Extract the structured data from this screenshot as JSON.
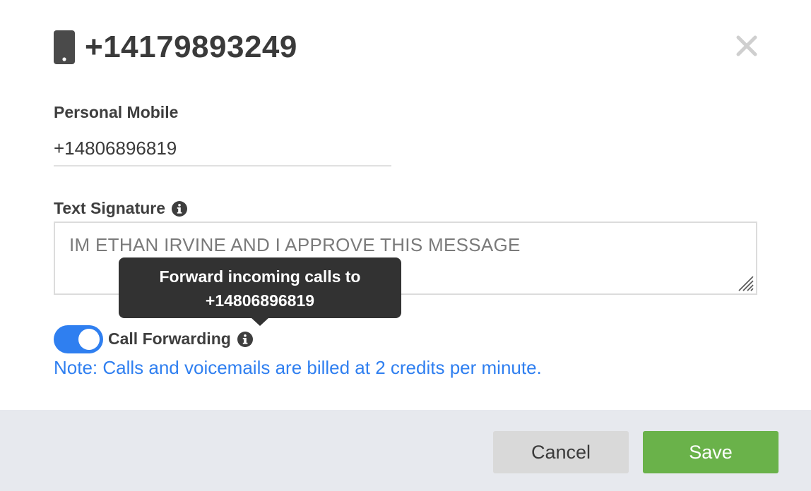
{
  "dialog": {
    "title": "+14179893249",
    "icons": {
      "title": "mobile-phone-icon",
      "close": "close-icon",
      "info": "info-icon"
    }
  },
  "personal_mobile": {
    "label": "Personal Mobile",
    "value": "+14806896819"
  },
  "text_signature": {
    "label": "Text Signature",
    "value": "IM ETHAN IRVINE AND I APPROVE THIS MESSAGE"
  },
  "tooltip": {
    "line1": "Forward incoming calls to",
    "line2": "+14806896819"
  },
  "call_forwarding": {
    "label": "Call Forwarding",
    "enabled": true,
    "note": "Note: Calls and voicemails are billed at 2 credits per minute."
  },
  "footer": {
    "cancel_label": "Cancel",
    "save_label": "Save"
  },
  "colors": {
    "accent": "#2f7ff0",
    "save": "#6ab24a",
    "cancel": "#d9d9d9",
    "tooltip": "#323232",
    "footer_bg": "#e7e9ee"
  }
}
